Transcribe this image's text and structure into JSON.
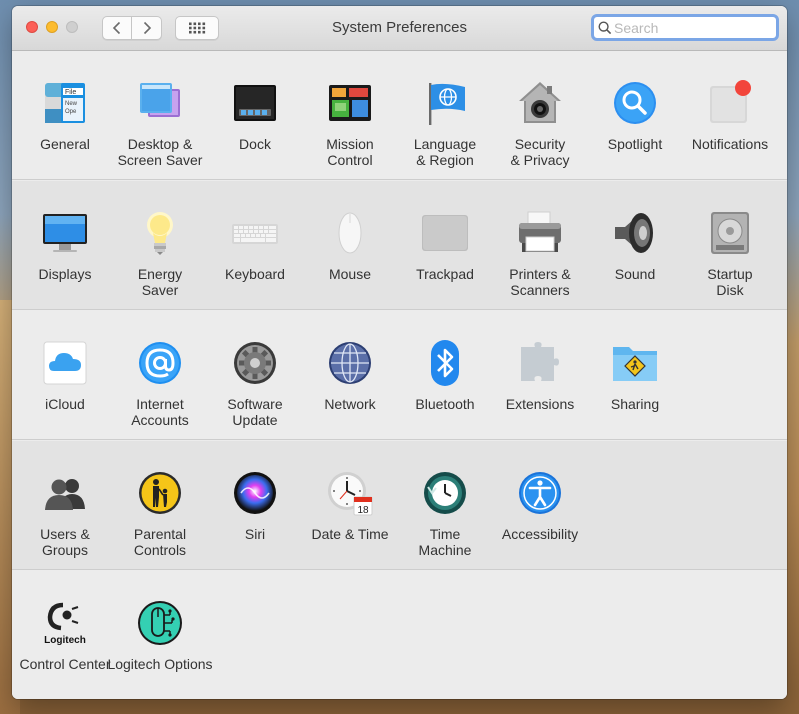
{
  "window": {
    "title": "System Preferences",
    "search_placeholder": "Search"
  },
  "sections": [
    [
      {
        "label": "General",
        "icon": "general-icon"
      },
      {
        "label": "Desktop &\nScreen Saver",
        "icon": "desktop-screensaver-icon"
      },
      {
        "label": "Dock",
        "icon": "dock-icon"
      },
      {
        "label": "Mission\nControl",
        "icon": "mission-control-icon"
      },
      {
        "label": "Language\n& Region",
        "icon": "flag-globe-icon"
      },
      {
        "label": "Security\n& Privacy",
        "icon": "house-lock-icon"
      },
      {
        "label": "Spotlight",
        "icon": "magnifier-icon"
      },
      {
        "label": "Notifications",
        "icon": "notification-badge-icon"
      }
    ],
    [
      {
        "label": "Displays",
        "icon": "monitor-icon"
      },
      {
        "label": "Energy\nSaver",
        "icon": "lightbulb-icon"
      },
      {
        "label": "Keyboard",
        "icon": "keyboard-icon"
      },
      {
        "label": "Mouse",
        "icon": "mouse-icon"
      },
      {
        "label": "Trackpad",
        "icon": "trackpad-icon"
      },
      {
        "label": "Printers &\nScanners",
        "icon": "printer-icon"
      },
      {
        "label": "Sound",
        "icon": "speaker-icon"
      },
      {
        "label": "Startup\nDisk",
        "icon": "hard-drive-icon"
      }
    ],
    [
      {
        "label": "iCloud",
        "icon": "cloud-icon"
      },
      {
        "label": "Internet\nAccounts",
        "icon": "at-sign-icon"
      },
      {
        "label": "Software\nUpdate",
        "icon": "gear-icon"
      },
      {
        "label": "Network",
        "icon": "globe-network-icon"
      },
      {
        "label": "Bluetooth",
        "icon": "bluetooth-icon"
      },
      {
        "label": "Extensions",
        "icon": "puzzle-piece-icon"
      },
      {
        "label": "Sharing",
        "icon": "sharing-folder-icon"
      }
    ],
    [
      {
        "label": "Users &\nGroups",
        "icon": "users-icon"
      },
      {
        "label": "Parental\nControls",
        "icon": "parental-controls-icon"
      },
      {
        "label": "Siri",
        "icon": "siri-icon"
      },
      {
        "label": "Date & Time",
        "icon": "clock-calendar-icon"
      },
      {
        "label": "Time\nMachine",
        "icon": "time-machine-icon"
      },
      {
        "label": "Accessibility",
        "icon": "accessibility-icon"
      }
    ],
    [
      {
        "label": "Control Center",
        "icon": "logitech-logo-icon",
        "logo_text": "Logitech"
      },
      {
        "label": "Logitech Options",
        "icon": "logitech-options-icon"
      }
    ]
  ],
  "calendar_day": "18",
  "colors": {
    "close": "#fc5f57",
    "minimize": "#fdbc2e",
    "zoom": "#cfcfcf",
    "search_focus": "#7ba6e6",
    "notification_dot": "#f2453b"
  }
}
